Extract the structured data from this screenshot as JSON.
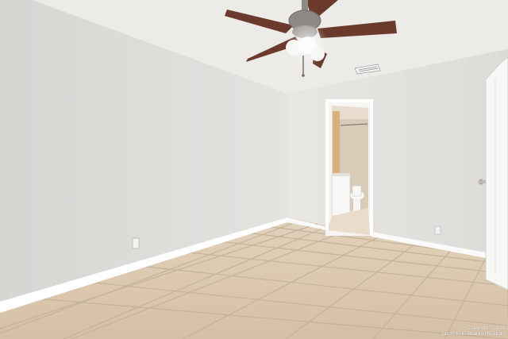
{
  "photo": {
    "watermark_lines": [
      "Copyright © 2025",
      "San Antonio Board of Realtors"
    ]
  },
  "palette": {
    "left_wall": "#ddddda",
    "back_wall": "#e6e5e2",
    "ceiling": "#ecebe8",
    "floor_tile": "#d9c5ab",
    "grout": "#bfae97",
    "baseboard": "#ffffff",
    "fan_blade": "#6b3a2c",
    "fan_metal": "#8d8a86"
  }
}
